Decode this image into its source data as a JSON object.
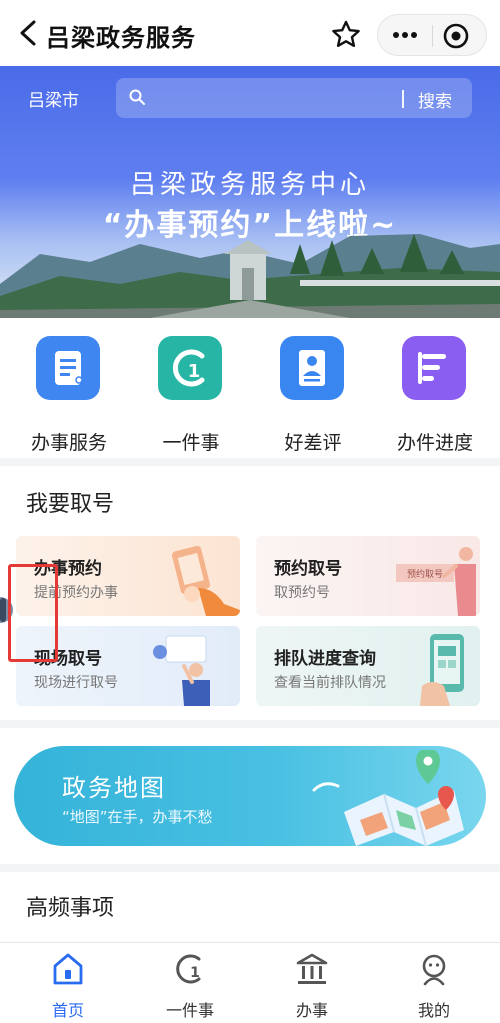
{
  "header": {
    "title": "吕梁政务服务"
  },
  "banner": {
    "city": "吕梁市",
    "search_button": "搜索",
    "line1": "吕梁政务服务中心",
    "line2": "“办事预约”上线啦~"
  },
  "quick_items": [
    {
      "label": "办事服务",
      "color": "#3f86f0",
      "icon": "document-icon"
    },
    {
      "label": "一件事",
      "color": "#27b6a6",
      "icon": "number-one-icon"
    },
    {
      "label": "好差评",
      "color": "#3a86f0",
      "icon": "profile-card-icon"
    },
    {
      "label": "办件进度",
      "color": "#8a5ef0",
      "icon": "progress-list-icon"
    }
  ],
  "queue": {
    "title": "我要取号",
    "cards": [
      {
        "title": "办事预约",
        "subtitle": "提前预约办事"
      },
      {
        "title": "预约取号",
        "subtitle": "取预约号",
        "art_label": "预约取号"
      },
      {
        "title": "现场取号",
        "subtitle": "现场进行取号"
      },
      {
        "title": "排队进度查询",
        "subtitle": "查看当前排队情况"
      }
    ]
  },
  "map_banner": {
    "title": "政务地图",
    "subtitle": "“地图”在手，办事不愁"
  },
  "high_frequency": {
    "title": "高频事项"
  },
  "tabbar": [
    {
      "label": "首页",
      "icon": "home-icon",
      "active": true
    },
    {
      "label": "一件事",
      "icon": "number-one-icon",
      "active": false
    },
    {
      "label": "办事",
      "icon": "government-building-icon",
      "active": false
    },
    {
      "label": "我的",
      "icon": "user-icon",
      "active": false
    }
  ],
  "colors": {
    "accent": "#2a6cf0",
    "highlight": "#e53935"
  }
}
